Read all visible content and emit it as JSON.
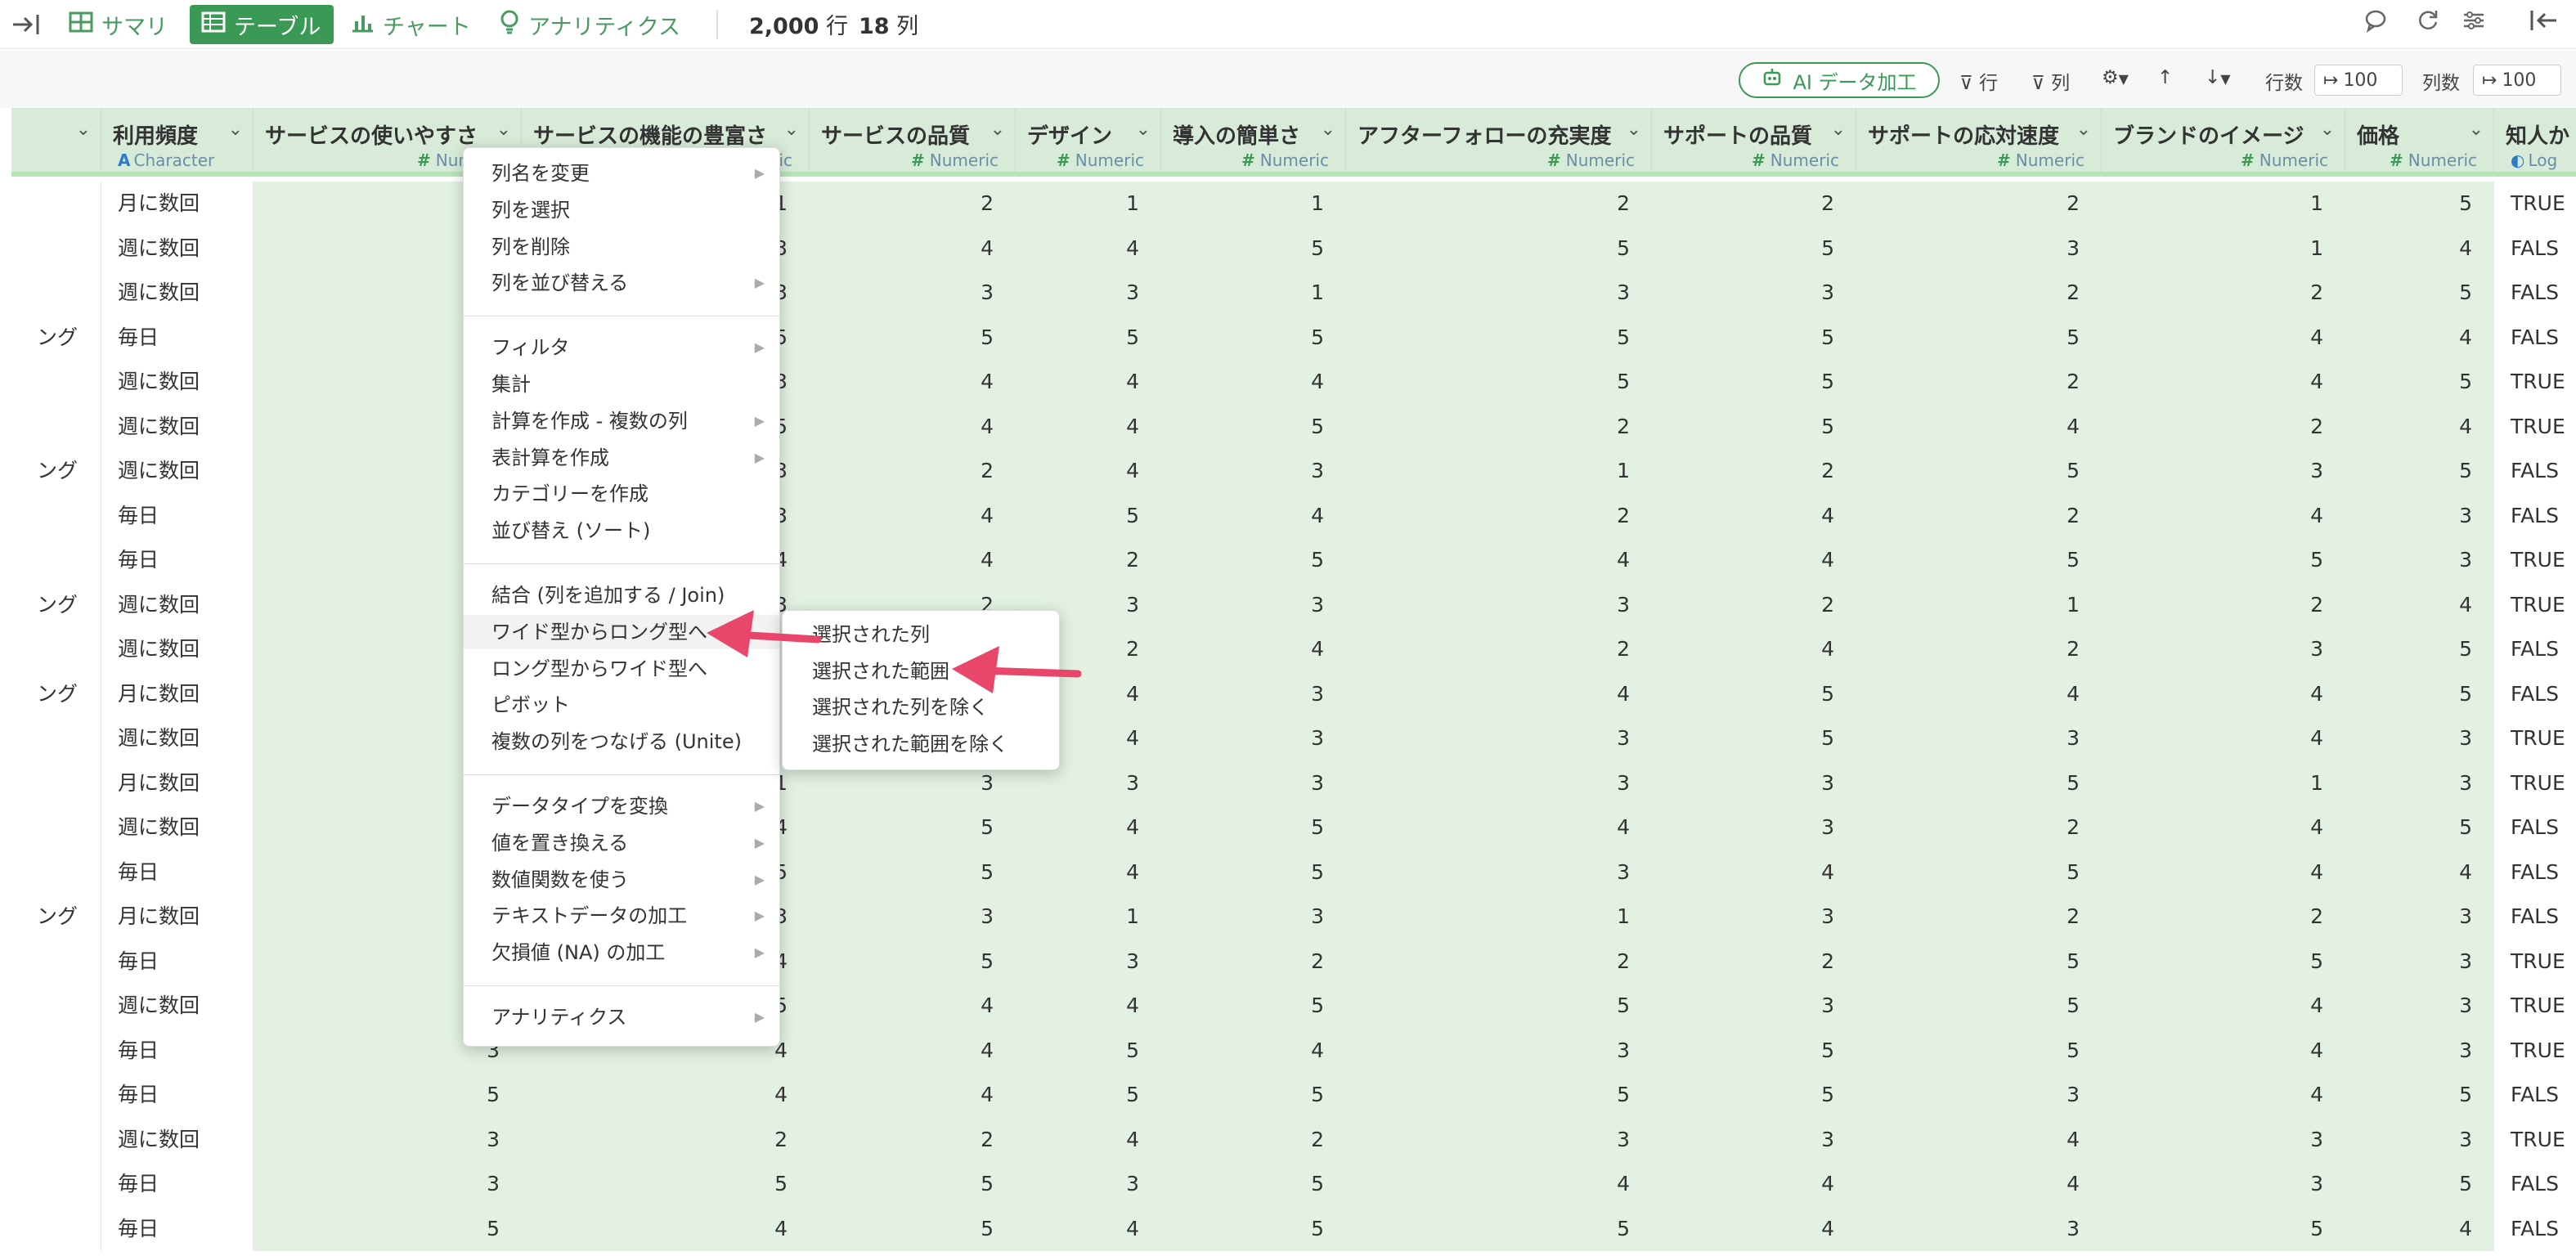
{
  "toolbar": {
    "summary_label": "サマリ",
    "table_label": "テーブル",
    "chart_label": "チャート",
    "analytics_label": "アナリティクス",
    "rows_value": "2,000",
    "rows_unit": "行",
    "cols_value": "18",
    "cols_unit": "列"
  },
  "toolbar2": {
    "ai_label": "AI データ加工",
    "row_filter": "行",
    "col_filter": "列",
    "rows_count_label": "行数",
    "rows_count_value": "100",
    "cols_count_label": "列数",
    "cols_count_value": "100"
  },
  "columns": [
    {
      "name": "",
      "type": ""
    },
    {
      "name": "利用頻度",
      "type": "Character"
    },
    {
      "name": "サービスの使いやすさ",
      "type": "Numeric"
    },
    {
      "name": "サービスの機能の豊富さ",
      "type": "Numeric"
    },
    {
      "name": "サービスの品質",
      "type": "Numeric"
    },
    {
      "name": "デザイン",
      "type": "Numeric"
    },
    {
      "name": "導入の簡単さ",
      "type": "Numeric"
    },
    {
      "name": "アフターフォローの充実度",
      "type": "Numeric"
    },
    {
      "name": "サポートの品質",
      "type": "Numeric"
    },
    {
      "name": "サポートの応対速度",
      "type": "Numeric"
    },
    {
      "name": "ブランドのイメージ",
      "type": "Numeric"
    },
    {
      "name": "価格",
      "type": "Numeric"
    },
    {
      "name": "知人か",
      "type": "Log"
    }
  ],
  "rows": [
    [
      "",
      "月に数回",
      "",
      "1",
      "2",
      "1",
      "1",
      "2",
      "2",
      "2",
      "1",
      "5",
      "TRUE"
    ],
    [
      "",
      "週に数回",
      "",
      "3",
      "4",
      "4",
      "5",
      "5",
      "5",
      "3",
      "1",
      "4",
      "FALS"
    ],
    [
      "",
      "週に数回",
      "",
      "3",
      "3",
      "3",
      "1",
      "3",
      "3",
      "2",
      "2",
      "5",
      "FALS"
    ],
    [
      "ング",
      "毎日",
      "",
      "5",
      "5",
      "5",
      "5",
      "5",
      "5",
      "5",
      "4",
      "4",
      "FALS"
    ],
    [
      "",
      "週に数回",
      "",
      "3",
      "4",
      "4",
      "4",
      "5",
      "5",
      "2",
      "4",
      "5",
      "TRUE"
    ],
    [
      "",
      "週に数回",
      "",
      "5",
      "4",
      "4",
      "5",
      "2",
      "5",
      "4",
      "2",
      "4",
      "TRUE"
    ],
    [
      "ング",
      "週に数回",
      "",
      "3",
      "2",
      "4",
      "3",
      "1",
      "2",
      "5",
      "3",
      "5",
      "FALS"
    ],
    [
      "",
      "毎日",
      "",
      "3",
      "4",
      "5",
      "4",
      "2",
      "4",
      "2",
      "4",
      "3",
      "FALS"
    ],
    [
      "",
      "毎日",
      "",
      "4",
      "4",
      "2",
      "5",
      "4",
      "4",
      "5",
      "5",
      "3",
      "TRUE"
    ],
    [
      "ング",
      "週に数回",
      "",
      "3",
      "2",
      "3",
      "3",
      "3",
      "2",
      "1",
      "2",
      "4",
      "TRUE"
    ],
    [
      "",
      "週に数回",
      "",
      "",
      "2",
      "2",
      "4",
      "2",
      "4",
      "2",
      "3",
      "5",
      "FALS"
    ],
    [
      "ング",
      "月に数回",
      "",
      "",
      "4",
      "4",
      "3",
      "4",
      "5",
      "4",
      "4",
      "5",
      "FALS"
    ],
    [
      "",
      "週に数回",
      "",
      "",
      "4",
      "4",
      "3",
      "3",
      "5",
      "3",
      "4",
      "3",
      "TRUE"
    ],
    [
      "",
      "月に数回",
      "",
      "1",
      "3",
      "3",
      "3",
      "3",
      "3",
      "5",
      "1",
      "3",
      "TRUE"
    ],
    [
      "",
      "週に数回",
      "",
      "4",
      "5",
      "4",
      "5",
      "4",
      "3",
      "2",
      "4",
      "5",
      "FALS"
    ],
    [
      "",
      "毎日",
      "",
      "5",
      "5",
      "4",
      "5",
      "3",
      "4",
      "5",
      "4",
      "4",
      "FALS"
    ],
    [
      "ング",
      "月に数回",
      "",
      "3",
      "3",
      "1",
      "3",
      "1",
      "3",
      "2",
      "2",
      "3",
      "FALS"
    ],
    [
      "",
      "毎日",
      "",
      "4",
      "5",
      "3",
      "2",
      "2",
      "2",
      "5",
      "5",
      "3",
      "TRUE"
    ],
    [
      "",
      "週に数回",
      "",
      "5",
      "4",
      "4",
      "5",
      "5",
      "3",
      "5",
      "4",
      "3",
      "TRUE"
    ],
    [
      "",
      "毎日",
      "3",
      "4",
      "4",
      "5",
      "4",
      "3",
      "5",
      "5",
      "4",
      "3",
      "TRUE"
    ],
    [
      "",
      "毎日",
      "5",
      "4",
      "4",
      "5",
      "5",
      "5",
      "5",
      "3",
      "4",
      "5",
      "FALS"
    ],
    [
      "",
      "週に数回",
      "3",
      "2",
      "2",
      "4",
      "2",
      "3",
      "3",
      "4",
      "3",
      "3",
      "TRUE"
    ],
    [
      "",
      "毎日",
      "3",
      "5",
      "5",
      "3",
      "5",
      "4",
      "4",
      "4",
      "3",
      "5",
      "FALS"
    ],
    [
      "",
      "毎日",
      "5",
      "4",
      "5",
      "4",
      "5",
      "5",
      "4",
      "3",
      "5",
      "4",
      "FALS"
    ]
  ],
  "context_menu": {
    "groups": [
      [
        {
          "label": "列名を変更",
          "submenu": true
        },
        {
          "label": "列を選択",
          "submenu": false
        },
        {
          "label": "列を削除",
          "submenu": false
        },
        {
          "label": "列を並び替える",
          "submenu": true
        }
      ],
      [
        {
          "label": "フィルタ",
          "submenu": true
        },
        {
          "label": "集計",
          "submenu": false
        },
        {
          "label": "計算を作成 - 複数の列",
          "submenu": true
        },
        {
          "label": "表計算を作成",
          "submenu": true
        },
        {
          "label": "カテゴリーを作成",
          "submenu": false
        },
        {
          "label": "並び替え (ソート)",
          "submenu": false
        }
      ],
      [
        {
          "label": "結合 (列を追加する / Join)",
          "submenu": false
        },
        {
          "label": "ワイド型からロング型へ",
          "submenu": false
        },
        {
          "label": "ロング型からワイド型へ",
          "submenu": false
        },
        {
          "label": "ピボット",
          "submenu": false
        },
        {
          "label": "複数の列をつなげる (Unite)",
          "submenu": false
        }
      ],
      [
        {
          "label": "データタイプを変換",
          "submenu": true
        },
        {
          "label": "値を置き換える",
          "submenu": true
        },
        {
          "label": "数値関数を使う",
          "submenu": true
        },
        {
          "label": "テキストデータの加工",
          "submenu": true
        },
        {
          "label": "欠損値 (NA) の加工",
          "submenu": true
        }
      ],
      [
        {
          "label": "アナリティクス",
          "submenu": true
        }
      ]
    ]
  },
  "submenu": {
    "items": [
      "選択された列",
      "選択された範囲",
      "選択された列を除く",
      "選択された範囲を除く"
    ]
  },
  "colors": {
    "accent": "#3a9a55",
    "arrow": "#e8466a",
    "numeric_cell_bg": "#e2f1e2"
  }
}
